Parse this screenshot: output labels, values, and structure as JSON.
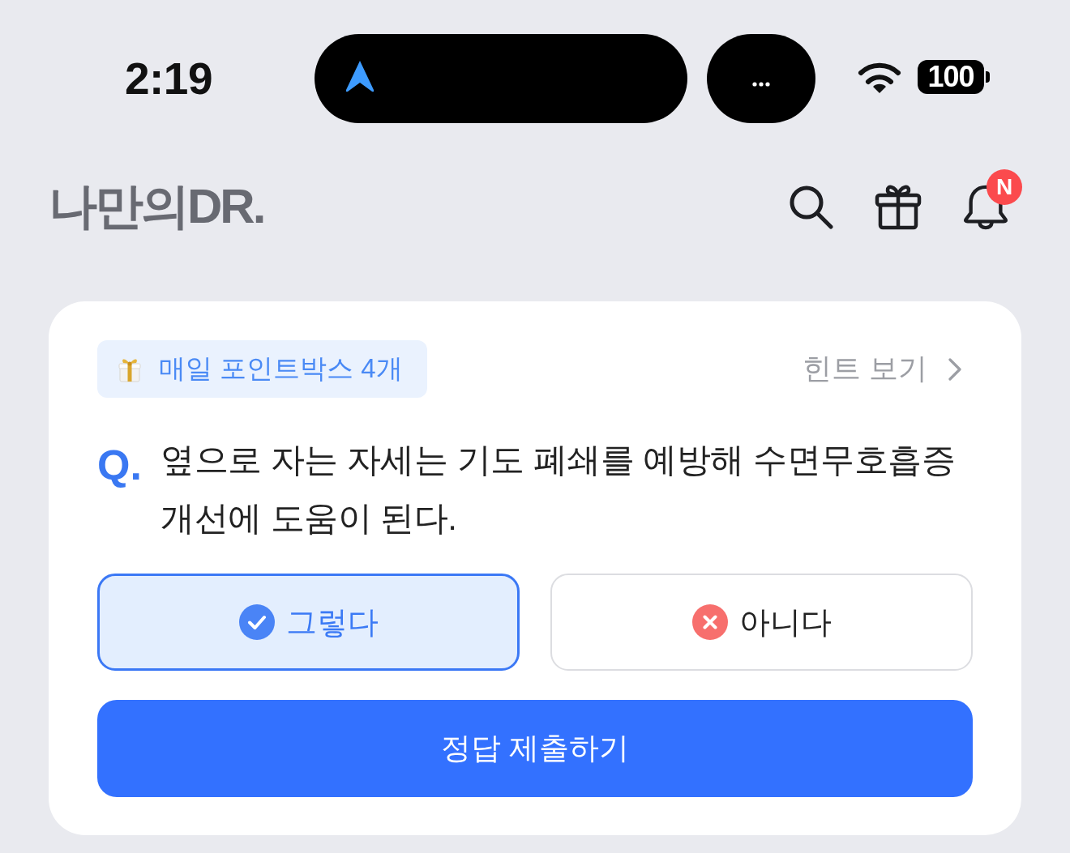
{
  "status_bar": {
    "time": "2:19",
    "battery": "100"
  },
  "header": {
    "logo": "나만의DR.",
    "notification_badge": "N"
  },
  "quiz": {
    "points_badge": "매일 포인트박스 4개",
    "hint_link": "힌트 보기",
    "question_prefix": "Q.",
    "question": "옆으로 자는 자세는 기도 폐쇄를 예방해 수면무호흡증 개선에 도움이 된다.",
    "options": [
      {
        "label": "그렇다",
        "kind": "yes",
        "selected": true
      },
      {
        "label": "아니다",
        "kind": "no",
        "selected": false
      }
    ],
    "submit_button": "정답 제출하기"
  }
}
